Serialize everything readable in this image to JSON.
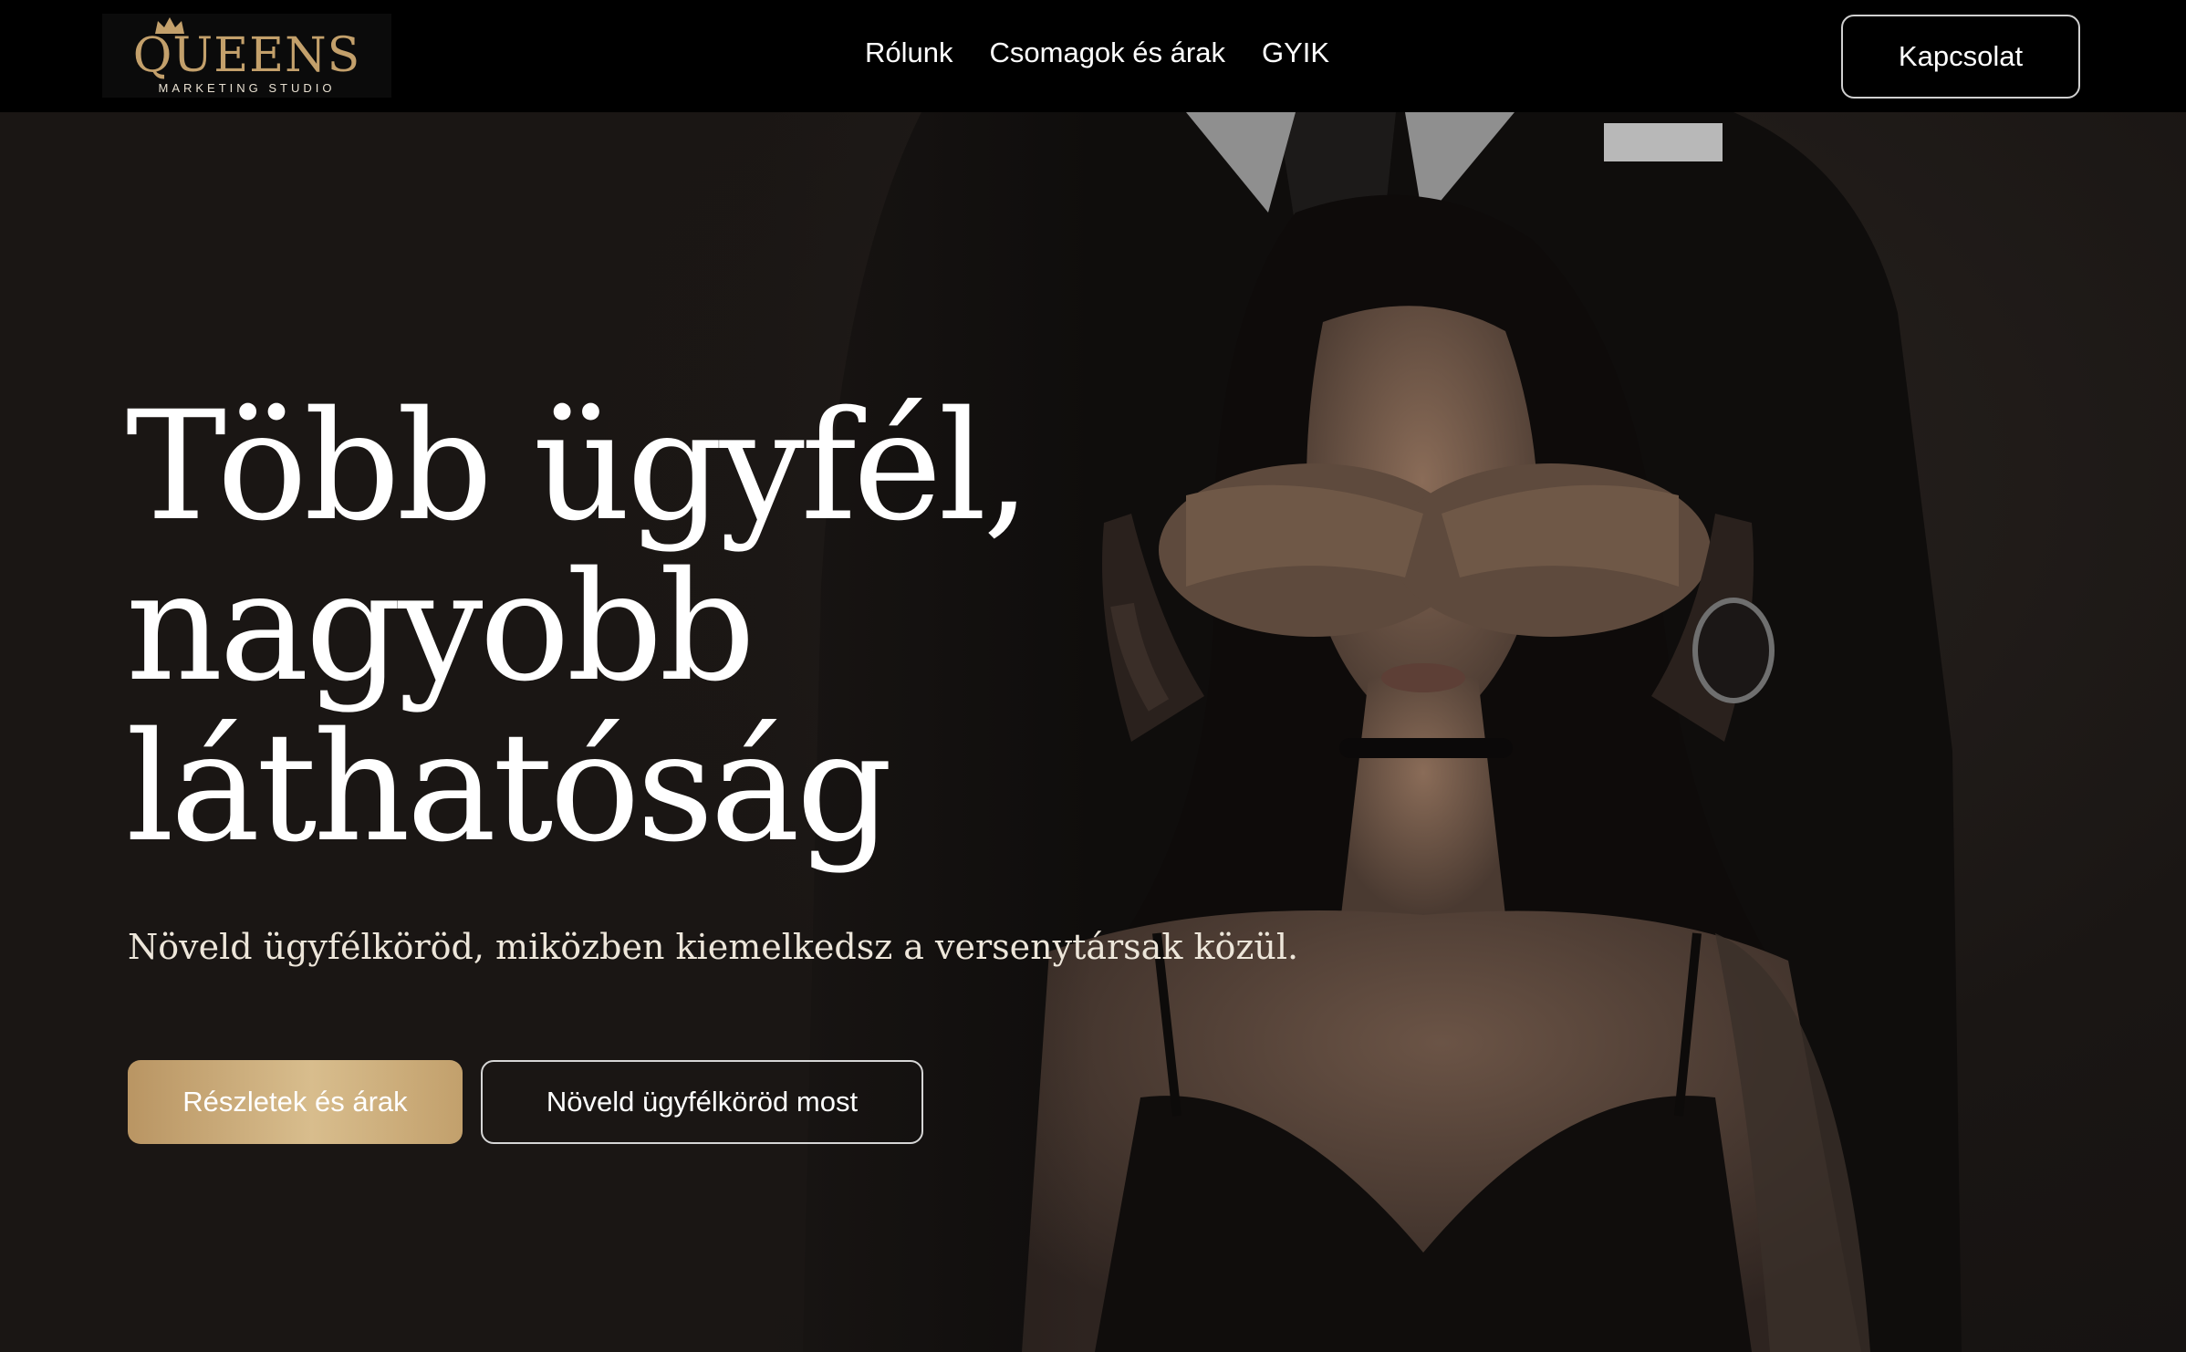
{
  "brand": {
    "name": "QUEENS",
    "tagline": "MARKETING STUDIO",
    "gold": "#c3a06b",
    "icon": "crown-icon"
  },
  "nav": {
    "items": [
      {
        "label": "Rólunk"
      },
      {
        "label": "Csomagok és árak"
      },
      {
        "label": "GYIK"
      }
    ],
    "contact_label": "Kapcsolat"
  },
  "hero": {
    "title_lines": [
      "Több ügyfél,",
      "nagyobb",
      "láthatóság"
    ],
    "subtitle": "Növeld ügyfélköröd, miközben kiemelkedsz a versenytársak közül.",
    "primary_cta": "Részletek és árak",
    "secondary_cta": "Növeld ügyfélköröd most",
    "accent_gradient": [
      "#b99563",
      "#d8bd8d"
    ]
  }
}
